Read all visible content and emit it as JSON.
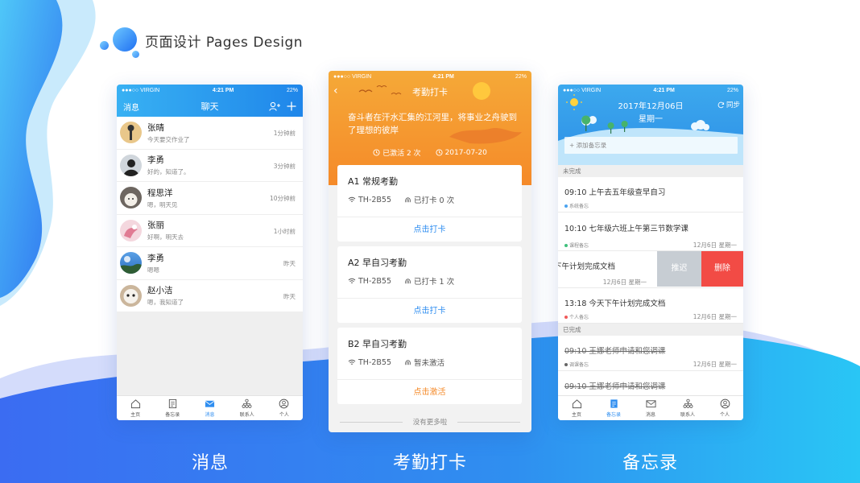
{
  "header": {
    "title": "页面设计 Pages Design"
  },
  "status": {
    "carrier": "●●●○○ VIRGIN",
    "time": "4:21 PM",
    "battery": "22%"
  },
  "phone1": {
    "nav": {
      "left": "消息",
      "title": "聊天"
    },
    "chats": [
      {
        "name": "张晴",
        "message": "今天要交作业了",
        "time": "1分钟前",
        "avatar_color": "#e9c78a"
      },
      {
        "name": "李勇",
        "message": "好的，知道了。",
        "time": "3分钟前",
        "avatar_color": "#d0d6dc"
      },
      {
        "name": "程思洋",
        "message": "嗯，明天见",
        "time": "10分钟前",
        "avatar_color": "#6d6660"
      },
      {
        "name": "张丽",
        "message": "好啊，明天去",
        "time": "1小时前",
        "avatar_color": "#e6b8c4"
      },
      {
        "name": "李勇",
        "message": "嗯嗯",
        "time": "昨天",
        "avatar_color": "#3d7fc8"
      },
      {
        "name": "赵小洁",
        "message": "嗯，我知道了",
        "time": "昨天",
        "avatar_color": "#cbb69c"
      }
    ],
    "tabs": [
      {
        "label": "主页",
        "icon": "home-icon"
      },
      {
        "label": "备忘录",
        "icon": "memo-icon"
      },
      {
        "label": "消息",
        "icon": "mail-icon",
        "active": true
      },
      {
        "label": "联系人",
        "icon": "contacts-icon"
      },
      {
        "label": "个人",
        "icon": "user-icon"
      }
    ]
  },
  "phone2": {
    "nav": {
      "title": "考勤打卡"
    },
    "quote": "奋斗者在汗水汇集的江河里，将事业之舟驶到了理想的彼岸",
    "activated": "已激活 2 次",
    "date": "2017-07-20",
    "cards": [
      {
        "title": "A1 常规考勤",
        "device": "TH-2B55",
        "count": "已打卡 0 次",
        "button": "点击打卡"
      },
      {
        "title": "A2 早自习考勤",
        "device": "TH-2B55",
        "count": "已打卡 1 次",
        "button": "点击打卡"
      },
      {
        "title": "B2 早自习考勤",
        "device": "TH-2B55",
        "count": "暂未激活",
        "button": "点击激活"
      }
    ],
    "no_more": "没有更多啦"
  },
  "phone3": {
    "date": "2017年12月06日",
    "weekday": "星期一",
    "sync": "同步",
    "add_placeholder": "添加备忘录",
    "section_pending": "未完成",
    "section_done": "已完成",
    "memos": [
      {
        "title": "09:10 上午去五年级查早自习",
        "tag": "系统备忘",
        "tag_color": "#4aa3f0"
      },
      {
        "title": "10:10   七年级六班上午第三节数学课",
        "tag": "课程备忘",
        "tag_color": "#3fc07c",
        "date": "12月6日  星期一"
      },
      {
        "title": "下午计划完成文档",
        "date": "12月6日  星期一"
      },
      {
        "title": "13:18   今天下午计划完成文档",
        "tag": "个人备忘",
        "tag_color": "#f05a5a",
        "date": "12月6日  星期一"
      },
      {
        "title": "09:10   王娜老师申请和您调课",
        "tag": "调课备忘",
        "tag_color": "#666666",
        "date": "12月6日  星期一"
      },
      {
        "title": "09:10   王娜老师申请和您调课"
      }
    ],
    "swipe_push": "推迟",
    "swipe_delete": "删除",
    "tabs": [
      {
        "label": "主页",
        "icon": "home-icon"
      },
      {
        "label": "备忘录",
        "icon": "memo-icon",
        "active": true
      },
      {
        "label": "消息",
        "icon": "mail-icon"
      },
      {
        "label": "联系人",
        "icon": "contacts-icon"
      },
      {
        "label": "个人",
        "icon": "user-icon"
      }
    ]
  },
  "captions": [
    "消息",
    "考勤打卡",
    "备忘录"
  ]
}
